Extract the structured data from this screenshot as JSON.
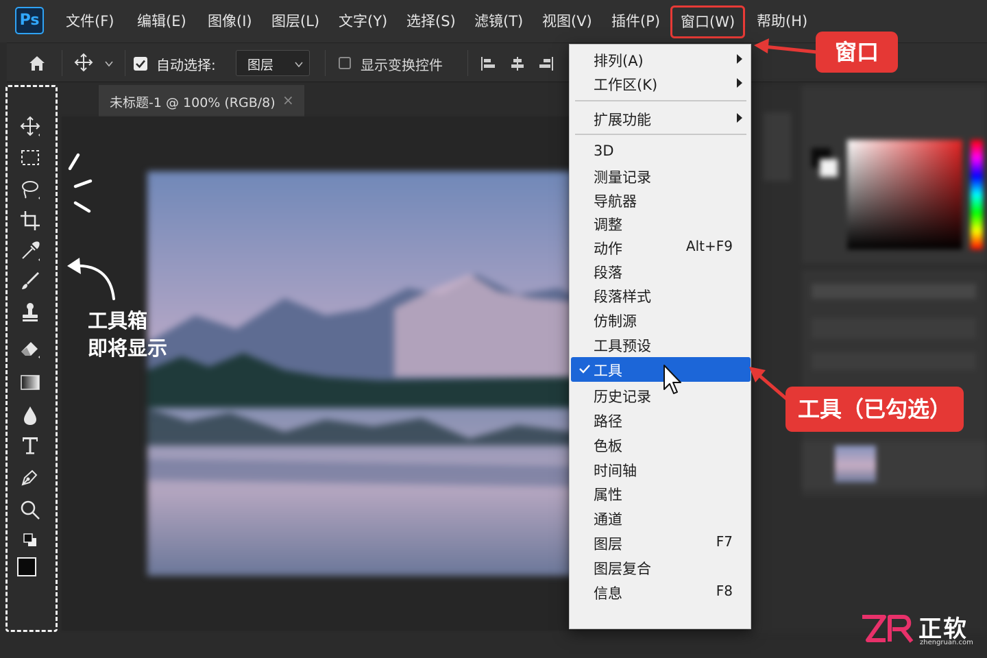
{
  "app": {
    "logo": "Ps"
  },
  "menubar": {
    "items": [
      {
        "label": "文件(F)"
      },
      {
        "label": "编辑(E)"
      },
      {
        "label": "图像(I)"
      },
      {
        "label": "图层(L)"
      },
      {
        "label": "文字(Y)"
      },
      {
        "label": "选择(S)"
      },
      {
        "label": "滤镜(T)"
      },
      {
        "label": "视图(V)"
      },
      {
        "label": "插件(P)"
      },
      {
        "label": "窗口(W)"
      },
      {
        "label": "帮助(H)"
      }
    ],
    "active_index": 9
  },
  "options_bar": {
    "auto_select_label": "自动选择:",
    "auto_select_checked": true,
    "layer_select_value": "图层",
    "show_transform_label": "显示变换控件",
    "show_transform_checked": false
  },
  "document_tab": {
    "title": "未标题-1 @ 100% (RGB/8)",
    "close_glyph": "×"
  },
  "window_menu": {
    "items": [
      {
        "label": "排列(A)",
        "submenu": true
      },
      {
        "label": "工作区(K)",
        "submenu": true
      },
      {
        "label": "扩展功能",
        "submenu": true
      },
      {
        "label": "3D"
      },
      {
        "label": "测量记录"
      },
      {
        "label": "导航器"
      },
      {
        "label": "调整"
      },
      {
        "label": "动作",
        "shortcut": "Alt+F9"
      },
      {
        "label": "段落"
      },
      {
        "label": "段落样式"
      },
      {
        "label": "仿制源"
      },
      {
        "label": "工具预设"
      },
      {
        "label": "工具",
        "checked": true,
        "highlighted": true
      },
      {
        "label": "历史记录"
      },
      {
        "label": "路径"
      },
      {
        "label": "色板"
      },
      {
        "label": "时间轴"
      },
      {
        "label": "属性"
      },
      {
        "label": "通道"
      },
      {
        "label": "图层",
        "shortcut": "F7"
      },
      {
        "label": "图层复合"
      },
      {
        "label": "信息",
        "shortcut": "F8"
      }
    ]
  },
  "annotations": {
    "window_callout": "窗口",
    "tool_callout": "工具（已勾选）",
    "toolbox_line1": "工具箱",
    "toolbox_line2": "即将显示"
  },
  "watermark": {
    "brand_cn": "正软",
    "url": "zhengruan.com"
  },
  "colors": {
    "accent_red": "#e53835",
    "menu_highlight": "#1c66d8",
    "ps_blue": "#31a8ff",
    "foreground_color": "#0a0a0a",
    "background_color": "#fafafa"
  }
}
